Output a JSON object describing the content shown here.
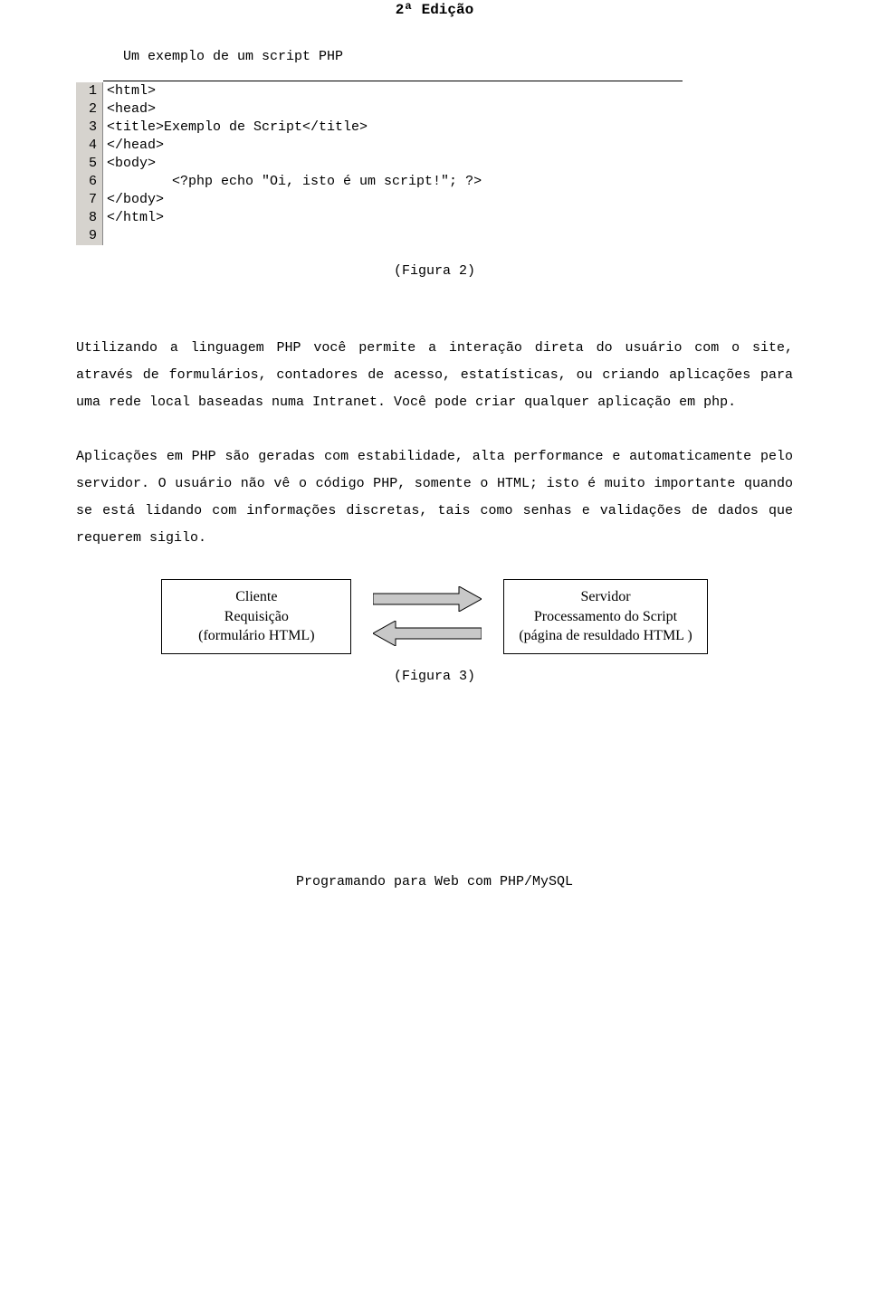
{
  "header": {
    "title": "2ª Edição"
  },
  "subtitle": "Um exemplo de um script PHP",
  "editor": {
    "lines": [
      {
        "n": "1",
        "code": "<html>"
      },
      {
        "n": "2",
        "code": "<head>"
      },
      {
        "n": "3",
        "code": "<title>Exemplo de Script</title>"
      },
      {
        "n": "4",
        "code": "</head>"
      },
      {
        "n": "5",
        "code": "<body>"
      },
      {
        "n": "6",
        "code": "        <?php echo \"Oi, isto é um script!\"; ?>"
      },
      {
        "n": "7",
        "code": "</body>"
      },
      {
        "n": "8",
        "code": "</html>"
      },
      {
        "n": "9",
        "code": ""
      }
    ]
  },
  "caption2": "(Figura 2)",
  "para1": "Utilizando a linguagem PHP você permite a interação direta do usuário com o site, através de formulários, contadores de acesso, estatísticas, ou criando aplicações para uma rede local baseadas numa Intranet. Você pode criar qualquer aplicação em php.",
  "para2": "Aplicações em PHP são geradas com estabilidade, alta performance e automaticamente pelo servidor. O usuário não vê o código PHP, somente o HTML; isto é muito importante quando se está lidando com informações discretas, tais como senhas e validações de dados que requerem sigilo.",
  "diagram": {
    "left": {
      "l1": "Cliente",
      "l2": "Requisição",
      "l3": "(formulário HTML)"
    },
    "right": {
      "l1": "Servidor",
      "l2": "Processamento do Script",
      "l3": "(página de resuldado HTML )"
    }
  },
  "caption3": "(Figura 3)",
  "footer": "Programando para Web com PHP/MySQL"
}
